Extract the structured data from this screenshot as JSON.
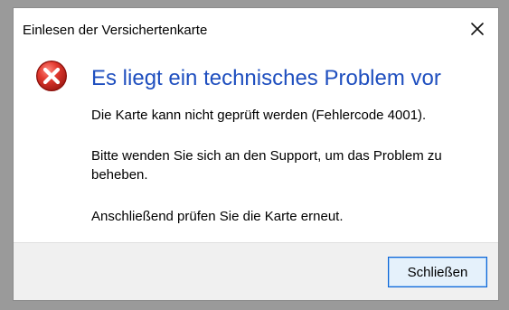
{
  "window": {
    "title": "Einlesen der Versichertenkarte"
  },
  "message": {
    "heading": "Es liegt ein technisches Problem vor",
    "line1": "Die Karte kann nicht geprüft werden (Fehlercode 4001).",
    "line2": "Bitte wenden Sie sich an den Support, um das Problem zu beheben.",
    "line3": "Anschließend prüfen Sie die Karte erneut."
  },
  "buttons": {
    "close_label": "Schließen"
  },
  "icons": {
    "error": "error-icon",
    "close": "close-icon"
  },
  "colors": {
    "heading": "#1f4fbf",
    "error_red": "#d9332b",
    "button_border": "#0a64d6",
    "button_bg": "#e5f1fb",
    "footer_bg": "#f0f0f0"
  }
}
